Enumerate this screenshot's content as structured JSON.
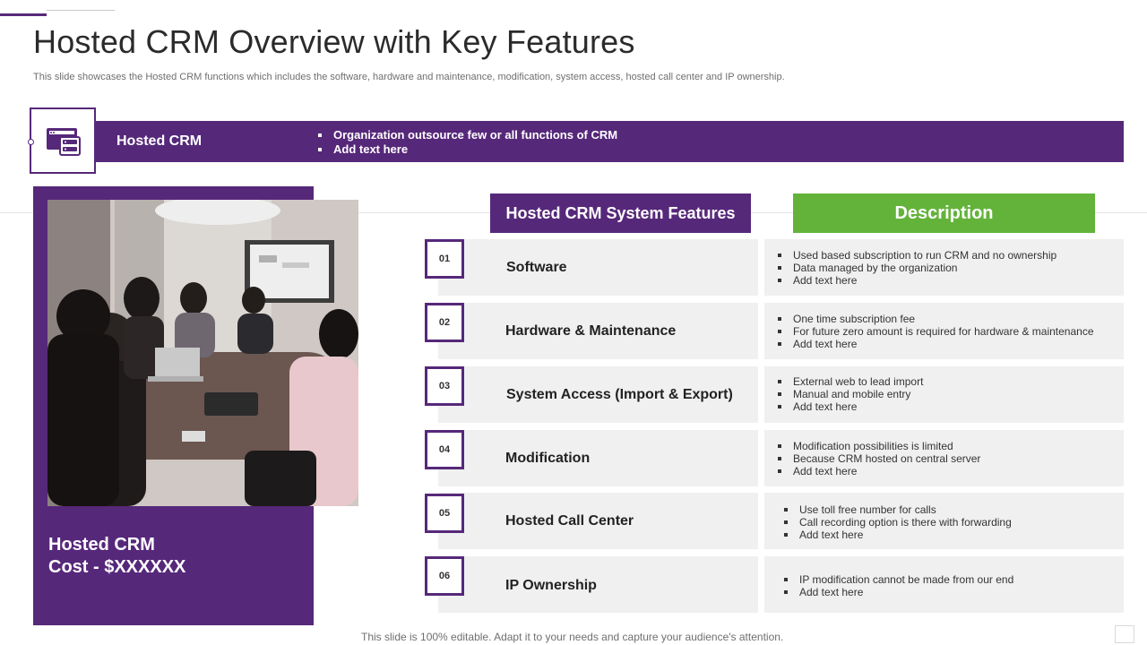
{
  "header": {
    "title": "Hosted CRM Overview with Key Features",
    "subtitle": "This slide showcases the Hosted CRM functions which includes the software, hardware and maintenance, modification, system access, hosted call center and IP ownership."
  },
  "banner": {
    "label": "Hosted CRM",
    "bullets": [
      "Organization outsource  few or all functions  of CRM",
      "Add text here"
    ],
    "icon": "server-monitor-icon"
  },
  "left_panel": {
    "photo_icon": "team-meeting-photo",
    "cost_line1": "Hosted CRM",
    "cost_line2": "Cost - $XXXXXX"
  },
  "table": {
    "features_header": "Hosted CRM System Features",
    "description_header": "Description",
    "rows": [
      {
        "num": "01",
        "feature": "Software",
        "desc": [
          "Used based subscription to run CRM and no ownership",
          "Data managed by the organization",
          "Add text here"
        ]
      },
      {
        "num": "02",
        "feature": "Hardware & Maintenance",
        "desc": [
          "One time subscription fee",
          "For future zero  amount is required for hardware & maintenance",
          "Add text here"
        ]
      },
      {
        "num": "03",
        "feature": "System Access (Import & Export)",
        "desc": [
          "External web to lead import",
          "Manual and mobile entry",
          "Add text here"
        ]
      },
      {
        "num": "04",
        "feature": "Modification",
        "desc": [
          "Modification possibilities is limited",
          "Because CRM hosted on central server",
          "Add text here"
        ]
      },
      {
        "num": "05",
        "feature": "Hosted Call Center",
        "desc": [
          "Use toll free number for calls",
          "Call recording option is there with forwarding",
          "Add text here"
        ]
      },
      {
        "num": "06",
        "feature": "IP Ownership",
        "desc": [
          "IP modification cannot be made from our end",
          "Add text here"
        ]
      }
    ]
  },
  "footer": {
    "note": "This slide is 100% editable. Adapt it to your needs and capture your audience's attention."
  },
  "colors": {
    "purple": "#56287a",
    "green": "#63b33a",
    "row_bg": "#f0f0f0"
  }
}
